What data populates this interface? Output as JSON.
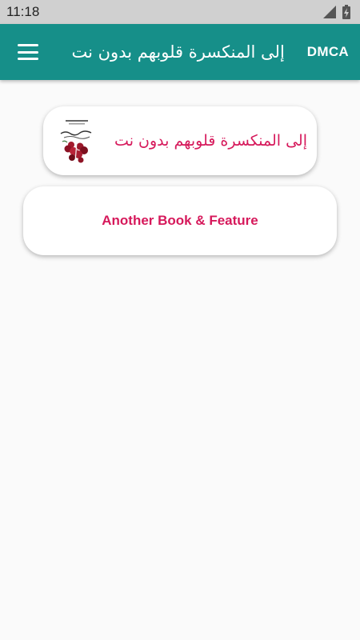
{
  "status_bar": {
    "time": "11:18",
    "signal_icon": "signal-icon",
    "battery_icon": "battery-charging-icon"
  },
  "app_bar": {
    "title": "إلى المنكسرة قلوبهم بدون نت",
    "menu_icon": "menu-icon",
    "dmca_label": "DMCA",
    "background": "#168f89"
  },
  "main": {
    "book_card": {
      "title": "إلى المنكسرة قلوبهم بدون نت",
      "cover_icon": "book-cover-image"
    },
    "feature_card": {
      "label": "Another Book & Feature"
    },
    "accent": "#d6195b"
  }
}
